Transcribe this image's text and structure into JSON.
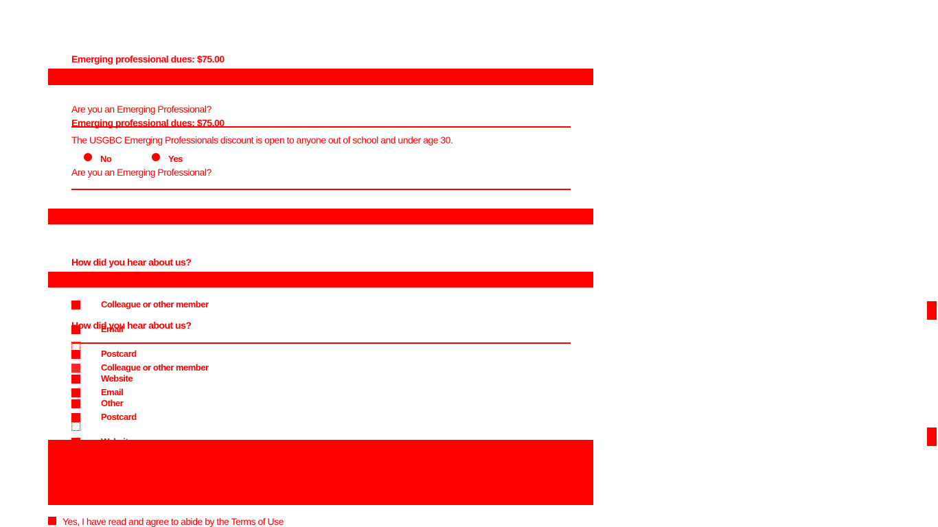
{
  "dues": {
    "label": "Emerging professional dues: $75.00"
  },
  "emerging": {
    "question": "Are you an Emerging Professional?",
    "description": "The USGBC Emerging Professionals discount is open to anyone out of school and under age 30.",
    "option_no": "No",
    "option_yes": "Yes"
  },
  "hear": {
    "question": "How did you hear about us?",
    "options": [
      "Colleague or other member",
      "Email",
      "Postcard",
      "Website",
      "Other"
    ]
  },
  "terms": {
    "label": "Yes, I have read and agree to abide by the Terms of Use"
  },
  "colors": {
    "primary": "#ff0000",
    "background": "#ffffff"
  }
}
